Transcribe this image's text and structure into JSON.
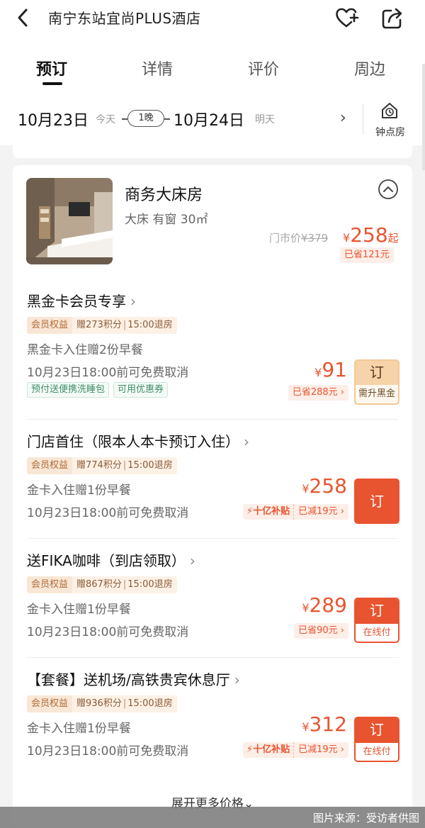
{
  "header": {
    "title": "南宁东站宜尚PLUS酒店"
  },
  "tabs": [
    {
      "label": "预订",
      "active": true
    },
    {
      "label": "详情",
      "active": false
    },
    {
      "label": "评价",
      "active": false
    },
    {
      "label": "周边",
      "active": false
    }
  ],
  "dates": {
    "checkin": "10月23日",
    "checkin_sub": "今天",
    "nights": "1晚",
    "checkout": "10月24日",
    "checkout_sub": "明天",
    "hourly_label": "钟点房"
  },
  "room": {
    "name": "商务大床房",
    "desc": "大床 有窗 30㎡",
    "list_price_label": "门市价",
    "list_price": "¥379",
    "currency": "¥",
    "price": "258",
    "price_suffix": "起",
    "saved": "已省121元"
  },
  "plans": [
    {
      "title": "黑金卡会员专享",
      "tag_a": "会员权益",
      "tag_points": "赠273积分",
      "tag_checkout": "15:00退房",
      "line1": "黑金卡入住赠2份早餐",
      "line2": "10月23日18:00前可免费取消",
      "green_tags": [
        "预付送便携洗睡包",
        "可用优惠券"
      ],
      "currency": "¥",
      "price": "91",
      "saved": "已省288元",
      "book_top": "订",
      "book_bottom": "需升黑金"
    },
    {
      "title": "门店首住（限本人本卡预订入住）",
      "tag_a": "会员权益",
      "tag_points": "赠774积分",
      "tag_checkout": "15:00退房",
      "line1": "金卡入住赠1份早餐",
      "line2": "10月23日18:00前可免费取消",
      "currency": "¥",
      "price": "258",
      "subsidy": "十亿补贴",
      "subsidy_off": "已减19元",
      "book_full": "订"
    },
    {
      "title": "送FIKA咖啡（到店领取）",
      "tag_a": "会员权益",
      "tag_points": "赠867积分",
      "tag_checkout": "15:00退房",
      "line1": "金卡入住赠1份早餐",
      "line2": "10月23日18:00前可免费取消",
      "currency": "¥",
      "price": "289",
      "saved": "已省90元",
      "book_top": "订",
      "book_bottom": "在线付"
    },
    {
      "title": "【套餐】送机场/高铁贵宾休息厅",
      "tag_a": "会员权益",
      "tag_points": "赠936积分",
      "tag_checkout": "15:00退房",
      "line1": "金卡入住赠1份早餐",
      "line2": "10月23日18:00前可免费取消",
      "currency": "¥",
      "price": "312",
      "subsidy": "十亿补贴",
      "subsidy_off": "已减19元",
      "book_top": "订",
      "book_bottom": "在线付"
    }
  ],
  "expand_more": "展开更多价格",
  "watermark": "图片来源：受访者供图",
  "colors": {
    "accent": "#e8542f",
    "member_tag_bg": "#f8e7d6",
    "gold_button": "#f6d3a8",
    "green_tag": "#3e8d6a"
  }
}
